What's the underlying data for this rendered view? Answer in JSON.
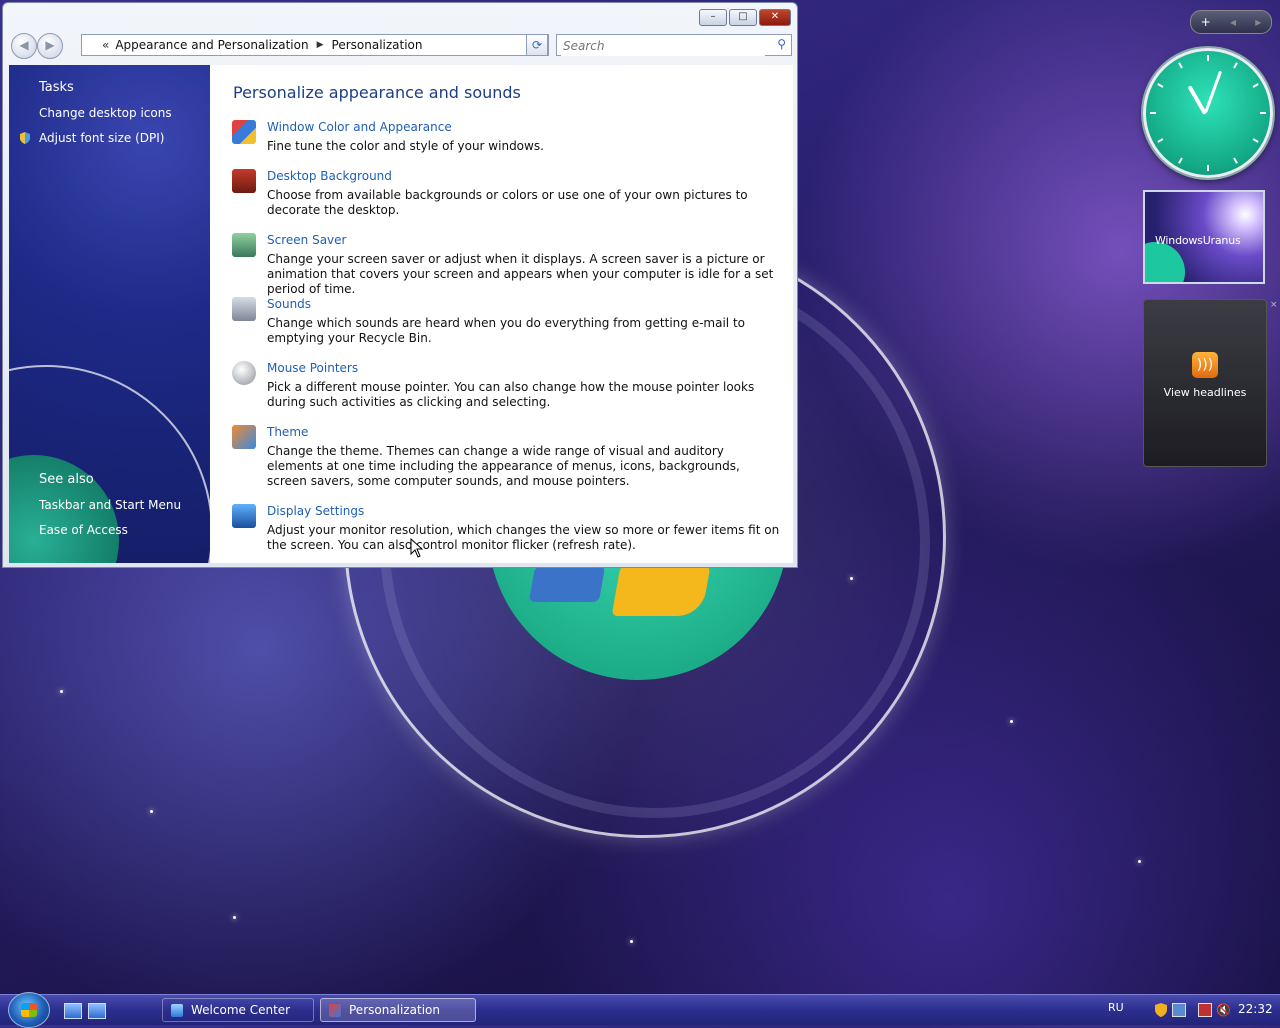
{
  "window": {
    "breadcrumb_prefix": "«",
    "breadcrumbs": [
      "Appearance and Personalization",
      "Personalization"
    ],
    "search_placeholder": "Search",
    "caption_minimize": "–",
    "caption_maximize": "□",
    "caption_close": "✕"
  },
  "sidebar": {
    "tasks_heading": "Tasks",
    "tasks": [
      "Change desktop icons",
      "Adjust font size (DPI)"
    ],
    "see_also_heading": "See also",
    "see_also": [
      "Taskbar and Start Menu",
      "Ease of Access"
    ]
  },
  "content": {
    "title": "Personalize appearance and sounds",
    "entries": [
      {
        "link": "Window Color and Appearance",
        "desc": "Fine tune the color and style of your windows.",
        "icon": "window-color-icon"
      },
      {
        "link": "Desktop Background",
        "desc": "Choose from available backgrounds or colors or use one of your own pictures to decorate the desktop.",
        "icon": "desktop-background-icon"
      },
      {
        "link": "Screen Saver",
        "desc": "Change your screen saver or adjust when it displays. A screen saver is a picture or animation that covers your screen and appears when your computer is idle for a set period of time.",
        "icon": "screen-saver-icon"
      },
      {
        "link": "Sounds",
        "desc": "Change which sounds are heard when you do everything from getting e-mail to emptying your Recycle Bin.",
        "icon": "sounds-icon"
      },
      {
        "link": "Mouse Pointers",
        "desc": "Pick a different mouse pointer. You can also change how the mouse pointer looks during such activities as clicking and selecting.",
        "icon": "mouse-icon"
      },
      {
        "link": "Theme",
        "desc": "Change the theme. Themes can change a wide range of visual and auditory elements at one time including the appearance of menus, icons, backgrounds, screen savers, some computer sounds, and mouse pointers.",
        "icon": "theme-icon"
      },
      {
        "link": "Display Settings",
        "desc": "Adjust your monitor resolution, which changes the view so more or fewer items fit on the screen. You can also control monitor flicker (refresh rate).",
        "icon": "display-icon"
      }
    ]
  },
  "gadgets": {
    "bar_add": "+",
    "bar_prev": "◂",
    "bar_next": "▸",
    "slideshow_caption": "WindowsUranus",
    "feed_label": "View headlines",
    "feed_close": "×"
  },
  "taskbar": {
    "tasks": [
      "Welcome Center",
      "Personalization"
    ],
    "language": "RU",
    "clock": "22:32"
  },
  "colors": {
    "link": "#1e5fb5",
    "heading": "#1b3e85",
    "clock_face": "#13a885",
    "taskbar": "#2c2e8e"
  }
}
